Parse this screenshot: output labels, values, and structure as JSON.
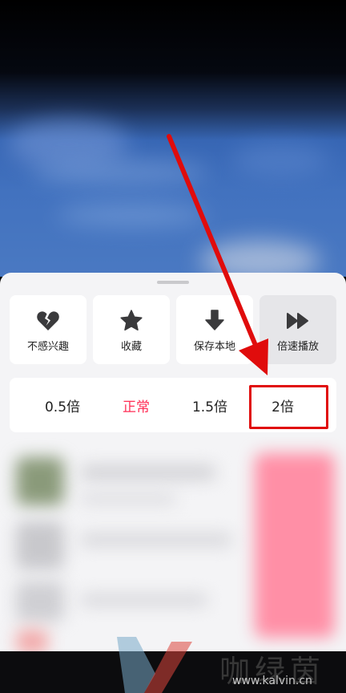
{
  "actions": [
    {
      "label": "不感兴趣",
      "icon": "broken-heart-icon"
    },
    {
      "label": "收藏",
      "icon": "star-icon"
    },
    {
      "label": "保存本地",
      "icon": "download-arrow-icon"
    },
    {
      "label": "倍速播放",
      "icon": "fast-forward-icon"
    }
  ],
  "speeds": [
    {
      "label": "0.5倍"
    },
    {
      "label": "正常"
    },
    {
      "label": "1.5倍"
    },
    {
      "label": "2倍"
    }
  ],
  "selected_speed": "正常",
  "annotation": {
    "highlight_color": "#e00c0c",
    "highlighted_option": "2倍"
  },
  "watermark": {
    "name": "咖绿茵",
    "url": "www.kalvin.cn"
  },
  "colors": {
    "accent": "#ff2d55",
    "sheet_bg": "#f4f4f6",
    "icon": "#3a3a3c"
  }
}
